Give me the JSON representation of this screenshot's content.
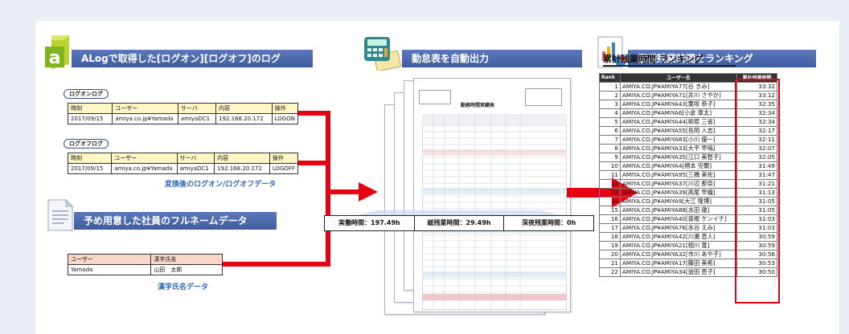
{
  "sections": {
    "alog": "ALogで取得した[ログオン][ログオフ]のログ",
    "timecard": "勤怠表を自動出力",
    "ranking": "累積残業時間をランキング",
    "fullname": "予め用意した社員のフルネームデータ"
  },
  "logon": {
    "label": "ログオンログ",
    "headers": [
      "時刻",
      "ユーザー",
      "サーバ",
      "内容",
      "操作"
    ],
    "row": [
      "2017/09/15",
      "amiya.co.jp¥Yamada",
      "amiyaDC1",
      "192.168.20.172",
      "LOGON"
    ]
  },
  "logoff": {
    "label": "ログオフログ",
    "headers": [
      "時刻",
      "ユーザー",
      "サーバ",
      "内容",
      "操作"
    ],
    "row": [
      "2017/09/15",
      "amiya.co.jp¥Yamada",
      "amiyaDC1",
      "192.168.20.172",
      "LOGOFF"
    ]
  },
  "converted_caption": "変換後のログオン/ログオフデータ",
  "names": {
    "headers": [
      "ユーザー",
      "漢字氏名"
    ],
    "row": [
      "Yamada",
      "山田　太郎"
    ],
    "caption": "漢字氏名データ"
  },
  "timesheet": {
    "title": "勤務時間実績表",
    "summary": [
      "実働時間：197.49h",
      "総残業時間：29.49h",
      "深夜残業時間：0h"
    ]
  },
  "ranking": {
    "title": "累計残業時間 ランキング",
    "headers": [
      "Rank",
      "ユーザー名",
      "累計残業時間"
    ],
    "rows": [
      [
        "1",
        "AMIYA.CO.JP¥AMIYA77[谷 きみ]",
        "33:32"
      ],
      [
        "2",
        "AMIYA.CO.JP¥AMIYA71[井川 さやか]",
        "33:12"
      ],
      [
        "3",
        "AMIYA.CO.JP¥AMIYA43[栗咲 恭子]",
        "32:35"
      ],
      [
        "4",
        "AMIYA.CO.JP¥AMIYA6[小倉 章太]",
        "32:34"
      ],
      [
        "5",
        "AMIYA.CO.JP¥AMIYA44[柳原 三省]",
        "32:34"
      ],
      [
        "6",
        "AMIYA.CO.JP¥AMIYA55[長岡 人志]",
        "32:17"
      ],
      [
        "7",
        "AMIYA.CO.JP¥AMIYA83[小川 優一]",
        "32:11"
      ],
      [
        "8",
        "AMIYA.CO.JP¥AMIYA33[大平 早嗚]",
        "32:07"
      ],
      [
        "9",
        "AMIYA.CO.JP¥AMIYA35[江口 美智子]",
        "32:05"
      ],
      [
        "10",
        "AMIYA.CO.JP¥AMIYA4[柄本 完爾]",
        "31:49"
      ],
      [
        "11",
        "AMIYA.CO.JP¥AMIYA95[三橋 美佐]",
        "31:47"
      ],
      [
        "12",
        "AMIYA.CO.JP¥AMIYA37[川辺 那奈]",
        "31:21"
      ],
      [
        "13",
        "AMIYA.CO.JP¥AMIYA39[高尾 早織]",
        "31:13"
      ],
      [
        "14",
        "AMIYA.CO.JP¥AMIYA9[大江 隆博]",
        "31:05"
      ],
      [
        "15",
        "AMIYA.CO.JP¥AMIYA88[水田 徹]",
        "31:05"
      ],
      [
        "16",
        "AMIYA.CO.JP¥AMIYA40[曽根 ケンイチ]",
        "31:03"
      ],
      [
        "17",
        "AMIYA.CO.JP¥AMIYA76[水谷 えみ]",
        "31:03"
      ],
      [
        "18",
        "AMIYA.CO.JP¥AMIYA42[川瀬 直人]",
        "30:59"
      ],
      [
        "19",
        "AMIYA.CO.JP¥AMIYA21[相川 寛]",
        "30:59"
      ],
      [
        "20",
        "AMIYA.CO.JP¥AMIYA32[市川 あや子]",
        "30:56"
      ],
      [
        "21",
        "AMIYA.CO.JP¥AMIYA17[藤田 美希]",
        "30:53"
      ],
      [
        "22",
        "AMIYA.CO.JP¥AMIYA34[益田 恵子]",
        "30:50"
      ]
    ]
  },
  "colors": {
    "banner": "#4a67a9",
    "arrow": "#e60012",
    "caption": "#2f68b9"
  },
  "icons": [
    "alog-logo-icon",
    "calculator-icon",
    "report-chart-icon",
    "document-icon"
  ]
}
